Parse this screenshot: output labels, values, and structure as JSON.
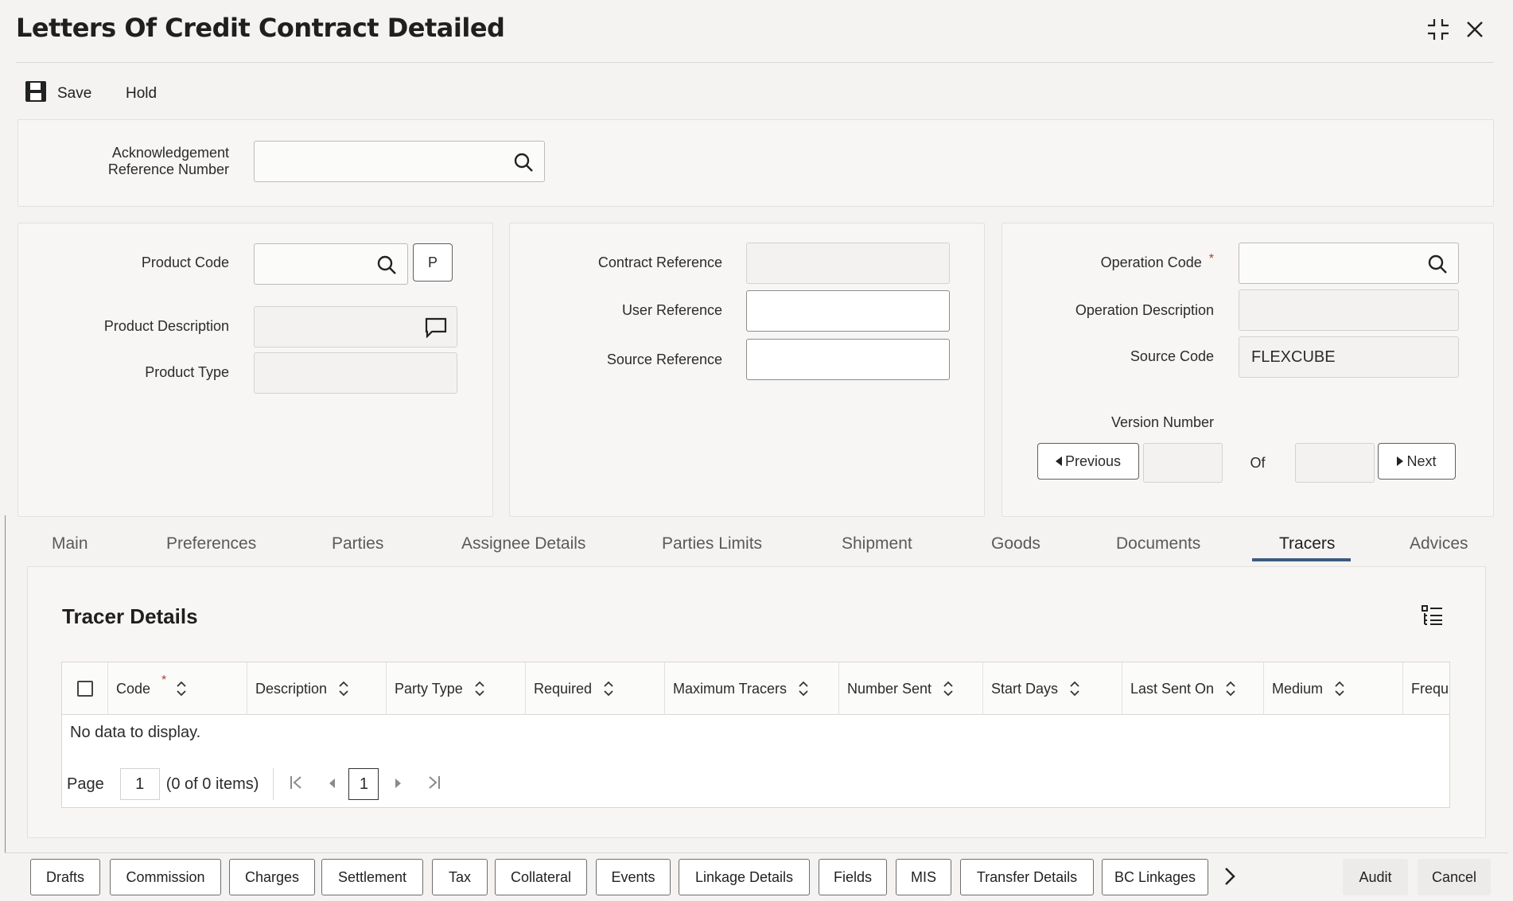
{
  "window": {
    "title": "Letters Of Credit Contract Detailed",
    "icons": [
      "minimize-icon",
      "close-icon"
    ]
  },
  "toolbar": {
    "save_label": "Save",
    "hold_label": "Hold"
  },
  "ack_panel": {
    "ack_ref_label_line1": "Acknowledgement",
    "ack_ref_label_line2": "Reference Number",
    "ack_ref_value": ""
  },
  "left_panel": {
    "product_code_label": "Product Code",
    "product_code_value": "",
    "p_button_label": "P",
    "product_description_label": "Product Description",
    "product_type_label": "Product Type"
  },
  "mid_panel": {
    "contract_reference_label": "Contract Reference",
    "user_reference_label": "User Reference",
    "source_reference_label": "Source Reference"
  },
  "right_panel": {
    "operation_code_label": "Operation Code",
    "required_mark": "*",
    "operation_description_label": "Operation Description",
    "source_code_label": "Source Code",
    "source_code_value": "FLEXCUBE",
    "version_number_label": "Version Number",
    "previous_label": "Previous",
    "of_label": "Of",
    "next_label": "Next"
  },
  "tabs": [
    {
      "label": "Main"
    },
    {
      "label": "Preferences"
    },
    {
      "label": "Parties"
    },
    {
      "label": "Assignee Details"
    },
    {
      "label": "Parties Limits"
    },
    {
      "label": "Shipment"
    },
    {
      "label": "Goods"
    },
    {
      "label": "Documents"
    },
    {
      "label": "Tracers"
    },
    {
      "label": "Advices"
    }
  ],
  "active_tab": "Tracers",
  "tracer_details": {
    "title": "Tracer Details",
    "columns": [
      "Code",
      "Description",
      "Party Type",
      "Required",
      "Maximum Tracers",
      "Number Sent",
      "Start Days",
      "Last Sent On",
      "Medium",
      "Frequ"
    ],
    "required_mark": "*",
    "no_data": "No data to display.",
    "page_label": "Page",
    "page_input": "1",
    "items_text": "(0 of 0 items)",
    "current_page": "1"
  },
  "footer": {
    "buttons": [
      "Drafts",
      "Commission",
      "Charges",
      "Settlement",
      "Tax",
      "Collateral",
      "Events",
      "Linkage Details",
      "Fields",
      "MIS",
      "Transfer Details",
      "BC Linkages"
    ],
    "audit_label": "Audit",
    "cancel_label": "Cancel"
  }
}
